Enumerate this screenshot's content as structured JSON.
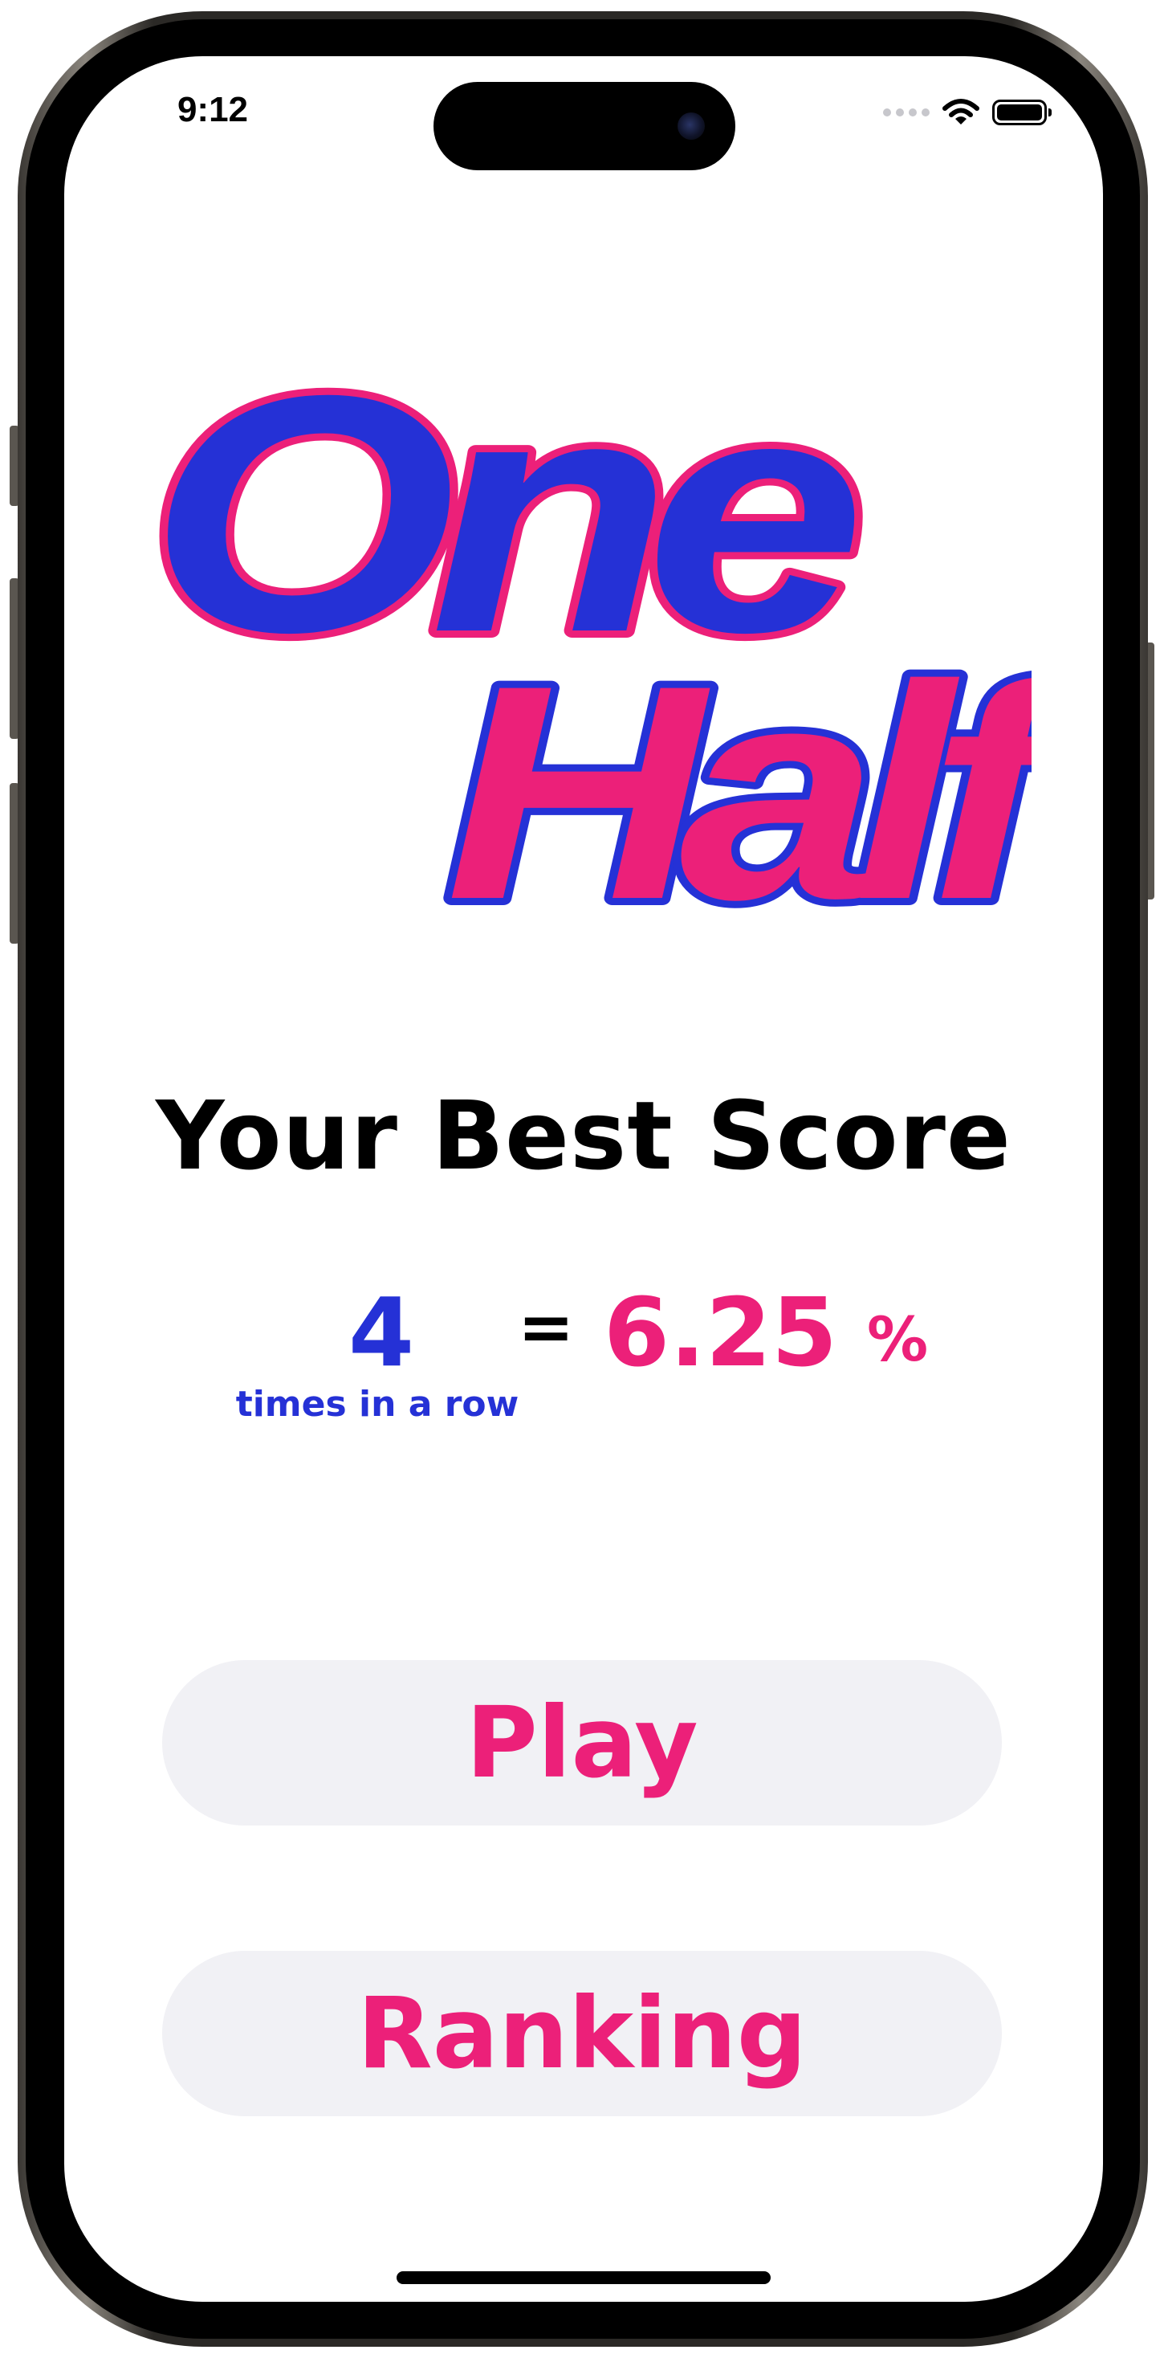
{
  "status_bar": {
    "time": "9:12",
    "icons": [
      "cellular-signal-icon",
      "wifi-icon",
      "battery-icon"
    ]
  },
  "logo": {
    "line1": "One",
    "line2": "Half",
    "colors": {
      "blue": "#2531d6",
      "pink": "#ec2079"
    }
  },
  "score": {
    "title": "Your Best Score",
    "streak_count": "4",
    "streak_caption": "times in a row",
    "equals": "=",
    "percent_value": "6.25",
    "percent_sign": "%"
  },
  "buttons": {
    "play_label": "Play",
    "ranking_label": "Ranking"
  },
  "colors": {
    "accent_pink": "#ec2079",
    "accent_blue": "#2531d6",
    "button_bg": "#f1f1f5"
  }
}
